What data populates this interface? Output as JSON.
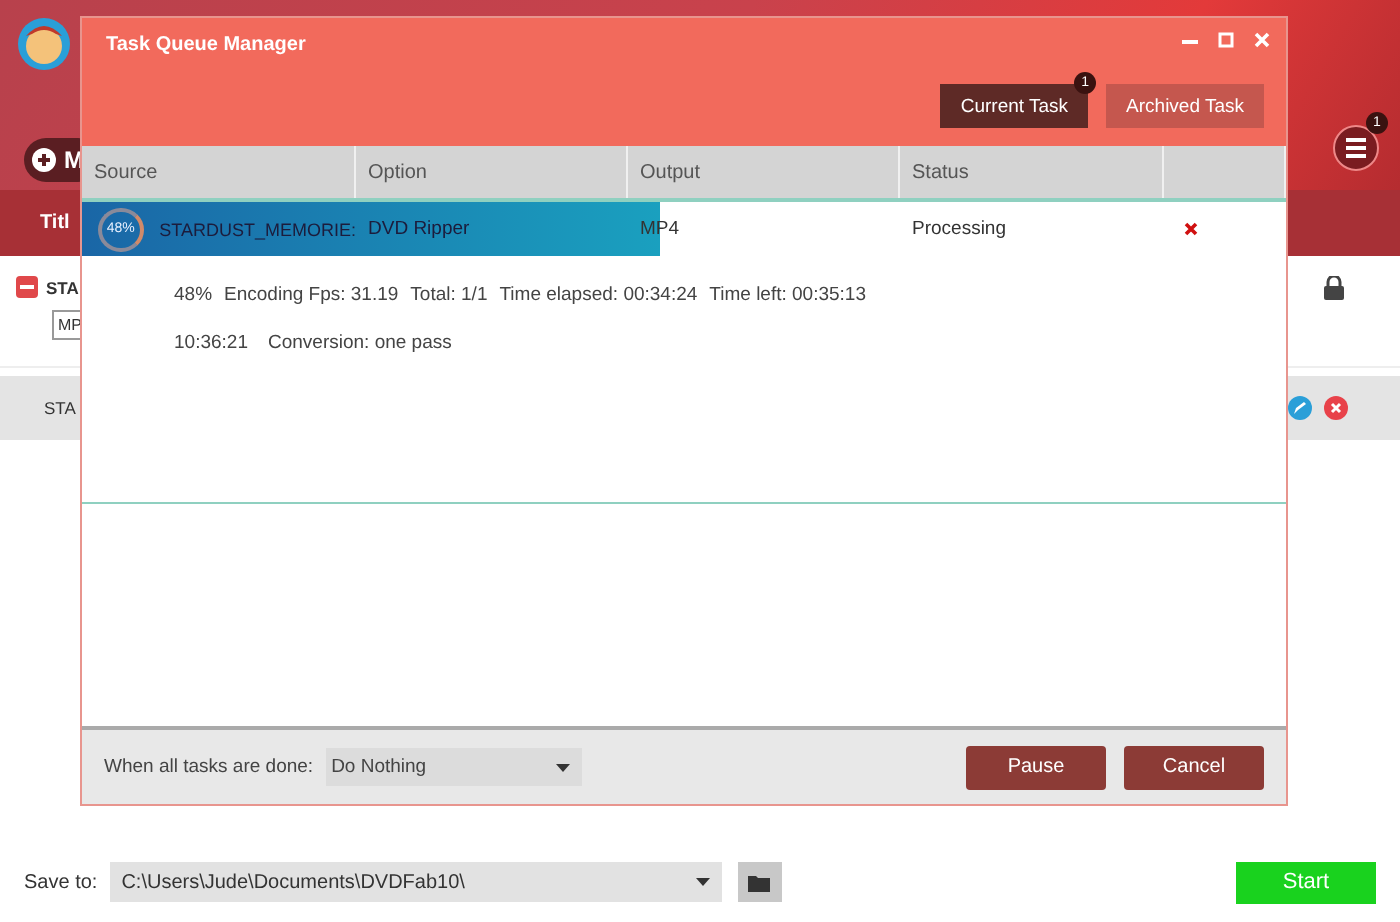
{
  "app": {
    "add_button": "M",
    "header_label": "Titl",
    "menu_badge": "1",
    "items": [
      {
        "kind": "source",
        "name": "STA",
        "format": "MP"
      },
      {
        "kind": "task",
        "name": "STA"
      }
    ]
  },
  "dialog": {
    "title": "Task Queue Manager",
    "tabs": [
      {
        "label": "Current Task",
        "selected": true,
        "badge": "1"
      },
      {
        "label": "Archived Task",
        "selected": false
      }
    ],
    "columns": [
      "Source",
      "Option",
      "Output",
      "Status"
    ],
    "rows": [
      {
        "percent": "48%",
        "source": "STARDUST_MEMORIE:",
        "option": "DVD Ripper",
        "output": "MP4",
        "status": "Processing",
        "level": 0.48
      }
    ],
    "details": [
      [
        "48%",
        "Encoding Fps: 31.19",
        "Total: 1/1",
        "Time elapsed: 00:34:24",
        "Time left: 00:35:13"
      ],
      [
        "10:36:21",
        "Conversion: one pass"
      ]
    ],
    "footer": {
      "label": "When all tasks are done:",
      "action": "Do Nothing",
      "buttons": [
        "Pause",
        "Cancel"
      ]
    }
  },
  "save_to": {
    "label": "Save to:",
    "path": "C:\\Users\\Jude\\Documents\\DVDFab10\\"
  },
  "start": "Start"
}
